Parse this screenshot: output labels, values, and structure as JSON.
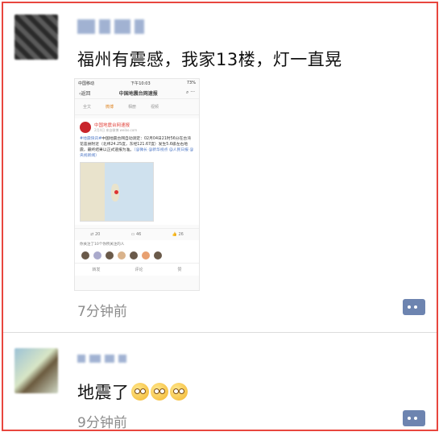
{
  "posts": [
    {
      "text": "福州有震感，我家13楼，灯一直晃",
      "time": "7分钟前",
      "screenshot": {
        "status_left": "中国移动",
        "status_time": "下午10:03",
        "status_right": "73%",
        "back_label": "返回",
        "nav_title": "中国地震台网速报",
        "tabs": [
          "全文",
          "微博",
          "相册",
          "视频"
        ],
        "account_name": "中国地震台网速报",
        "account_meta": "2月4日 来自微博 weibo.com",
        "hashtag": "#地震快讯#",
        "body": "中国地震台网自动测定：02月04日21时56分在台湾花莲县附近（北纬24.25度，东经121.67度）发生5.6级左右地震，最终结果以正式速报为准。",
        "mentions": "（@微长 @新华视点 @人民日报 @央视新闻）",
        "repost_count": "20",
        "comment_count": "46",
        "like_count": "26",
        "followers_line": "你关注了10个你所关注的人",
        "bottom": [
          "转发",
          "评论",
          "赞"
        ]
      }
    },
    {
      "text": "地震了",
      "time": "9分钟前",
      "emoji_count": 3
    }
  ]
}
